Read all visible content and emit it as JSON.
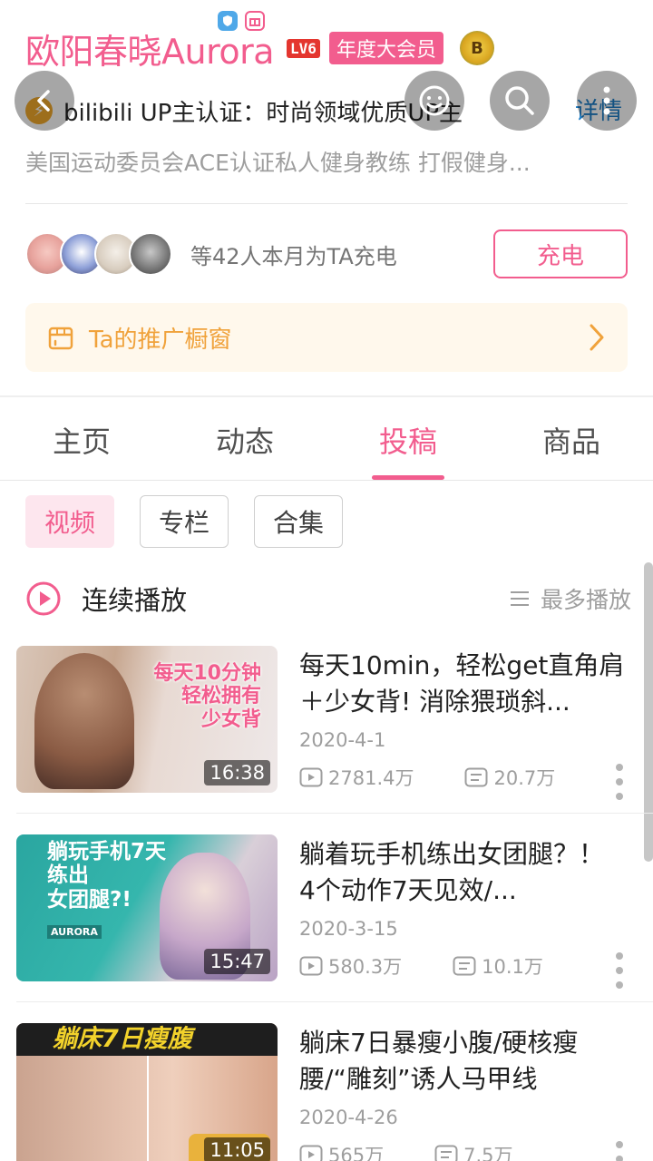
{
  "profile": {
    "username": "欧阳春晓Aurora",
    "level": "LV6",
    "vip_label": "年度大会员",
    "medal_glyph": "B",
    "certification": "bilibili UP主认证：时尚领域优质UP主",
    "detail_link": "详情",
    "bio": "美国运动委员会ACE认证私人健身教练 打假健身..."
  },
  "charge": {
    "text": "等42人本月为TA充电",
    "button": "充电"
  },
  "shop": {
    "label": "Ta的推广橱窗"
  },
  "tabs": [
    {
      "label": "主页",
      "active": false
    },
    {
      "label": "动态",
      "active": false
    },
    {
      "label": "投稿",
      "active": true
    },
    {
      "label": "商品",
      "active": false
    }
  ],
  "chips": [
    {
      "label": "视频",
      "active": true
    },
    {
      "label": "专栏",
      "active": false
    },
    {
      "label": "合集",
      "active": false
    }
  ],
  "play_bar": {
    "label": "连续播放",
    "sort": "最多播放"
  },
  "videos": [
    {
      "title": "每天10min，轻松get直角肩＋少女背! 消除猥琐斜...",
      "date": "2020-4-1",
      "views": "2781.4万",
      "danmaku": "20.7万",
      "duration": "16:38",
      "thumb_lines": [
        "每天10分钟",
        "轻松拥有",
        "少女背"
      ]
    },
    {
      "title": "躺着玩手机练出女团腿？！ 4个动作7天见效/...",
      "date": "2020-3-15",
      "views": "580.3万",
      "danmaku": "10.1万",
      "duration": "15:47",
      "thumb_lines": [
        "躺玩手机7天",
        "练出",
        "女团腿?!"
      ],
      "thumb_brand": "AURORA"
    },
    {
      "title": "躺床7日暴瘦小腹/硬核瘦腰/“雕刻”诱人马甲线",
      "date": "2020-4-26",
      "views": "565万",
      "danmaku": "7.5万",
      "duration": "11:05",
      "thumb_lines": [
        "躺床7日瘦腹"
      ]
    }
  ],
  "colors": {
    "accent": "#f25d8e",
    "shop": "#f0a23b",
    "link": "#1e7fc8"
  }
}
